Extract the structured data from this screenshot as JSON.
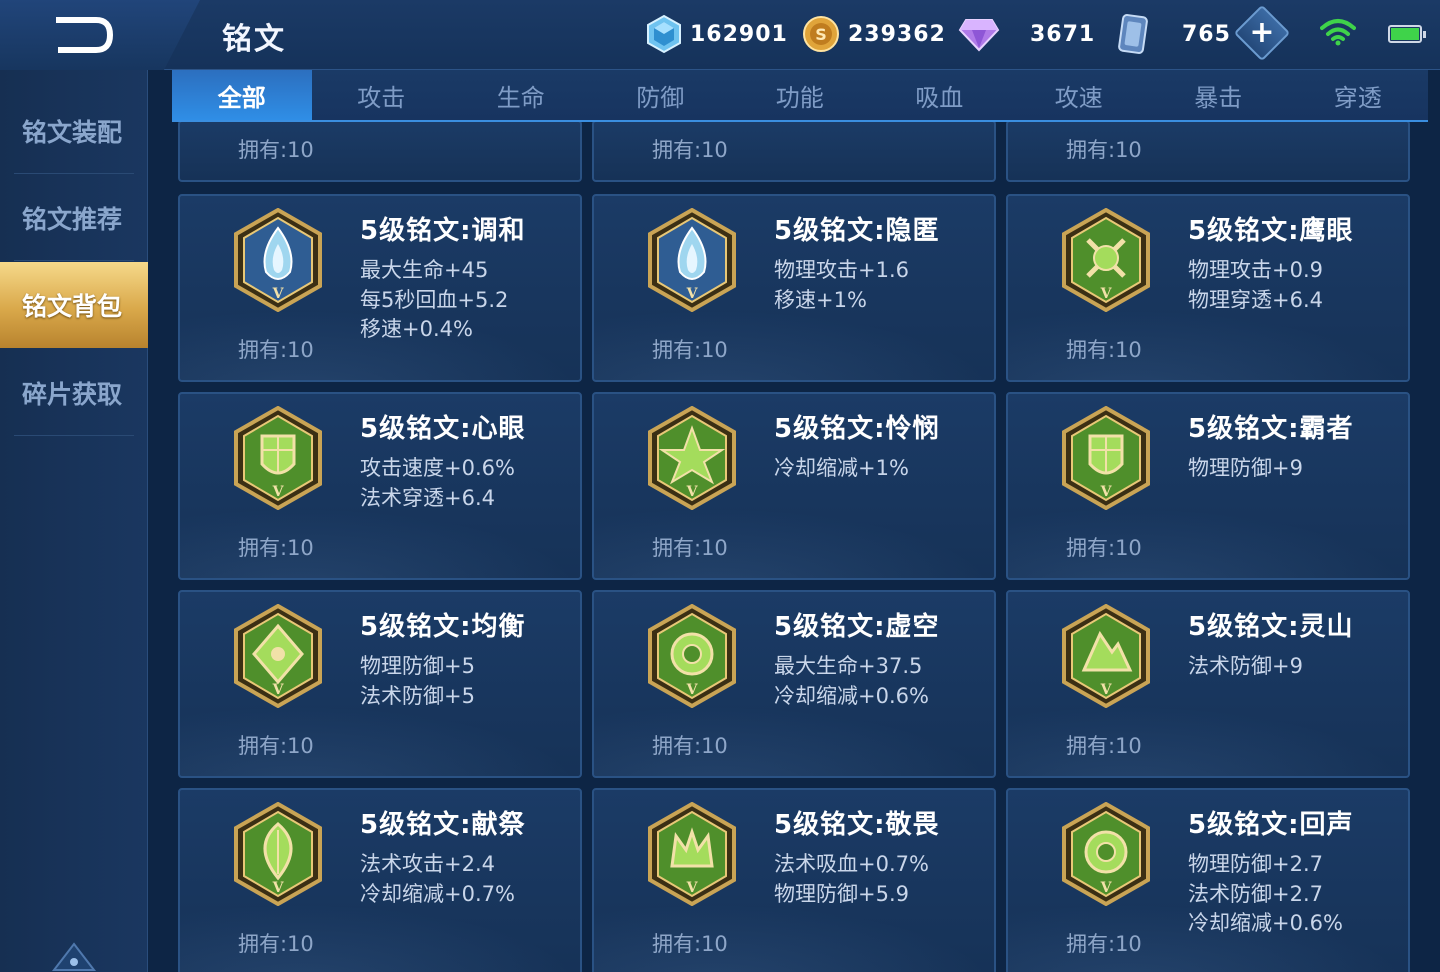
{
  "header": {
    "title": "铭文",
    "currencies": {
      "diamond": "162901",
      "coin": "239362",
      "gem": "3671",
      "card": "765"
    },
    "plus_label": "+"
  },
  "sidebar": {
    "items": [
      {
        "label": "铭文装配"
      },
      {
        "label": "铭文推荐"
      },
      {
        "label": "铭文背包"
      },
      {
        "label": "碎片获取"
      }
    ],
    "active_index": 2
  },
  "tabs": {
    "items": [
      "全部",
      "攻击",
      "生命",
      "防御",
      "功能",
      "吸血",
      "攻速",
      "暴击",
      "穿透"
    ],
    "active_index": 0
  },
  "owned_label": "拥有:10",
  "top_partial_cards": [
    {
      "owned": "拥有:10"
    },
    {
      "owned": "拥有:10"
    },
    {
      "owned": "拥有:10"
    }
  ],
  "cards": [
    {
      "name": "5级铭文:调和",
      "stats": [
        "最大生命+45",
        "每5秒回血+5.2",
        "移速+0.4%"
      ],
      "owned": "拥有:10",
      "color": "blue",
      "glyph": "flame-light"
    },
    {
      "name": "5级铭文:隐匿",
      "stats": [
        "物理攻击+1.6",
        "移速+1%"
      ],
      "owned": "拥有:10",
      "color": "blue",
      "glyph": "flame"
    },
    {
      "name": "5级铭文:鹰眼",
      "stats": [
        "物理攻击+0.9",
        "物理穿透+6.4"
      ],
      "owned": "拥有:10",
      "color": "green",
      "glyph": "cross"
    },
    {
      "name": "5级铭文:心眼",
      "stats": [
        "攻击速度+0.6%",
        "法术穿透+6.4"
      ],
      "owned": "拥有:10",
      "color": "green",
      "glyph": "gate"
    },
    {
      "name": "5级铭文:怜悯",
      "stats": [
        "冷却缩减+1%"
      ],
      "owned": "拥有:10",
      "color": "green",
      "glyph": "star"
    },
    {
      "name": "5级铭文:霸者",
      "stats": [
        "物理防御+9"
      ],
      "owned": "拥有:10",
      "color": "green",
      "glyph": "shield"
    },
    {
      "name": "5级铭文:均衡",
      "stats": [
        "物理防御+5",
        "法术防御+5"
      ],
      "owned": "拥有:10",
      "color": "green",
      "glyph": "diamond"
    },
    {
      "name": "5级铭文:虚空",
      "stats": [
        "最大生命+37.5",
        "冷却缩减+0.6%"
      ],
      "owned": "拥有:10",
      "color": "green",
      "glyph": "ring"
    },
    {
      "name": "5级铭文:灵山",
      "stats": [
        "法术防御+9"
      ],
      "owned": "拥有:10",
      "color": "green",
      "glyph": "mountain"
    },
    {
      "name": "5级铭文:献祭",
      "stats": [
        "法术攻击+2.4",
        "冷却缩减+0.7%"
      ],
      "owned": "拥有:10",
      "color": "green",
      "glyph": "leaf"
    },
    {
      "name": "5级铭文:敬畏",
      "stats": [
        "法术吸血+0.7%",
        "物理防御+5.9"
      ],
      "owned": "拥有:10",
      "color": "green",
      "glyph": "crown"
    },
    {
      "name": "5级铭文:回声",
      "stats": [
        "物理防御+2.7",
        "法术防御+2.7",
        "冷却缩减+0.6%"
      ],
      "owned": "拥有:10",
      "color": "green",
      "glyph": "swirl"
    }
  ],
  "colors": {
    "accent_blue": "#2f8ee6",
    "active_gold": "#d9a84a",
    "emblem_green": "#7fc244",
    "emblem_blue": "#9fd6ef",
    "emblem_gold": "#c9a455"
  }
}
